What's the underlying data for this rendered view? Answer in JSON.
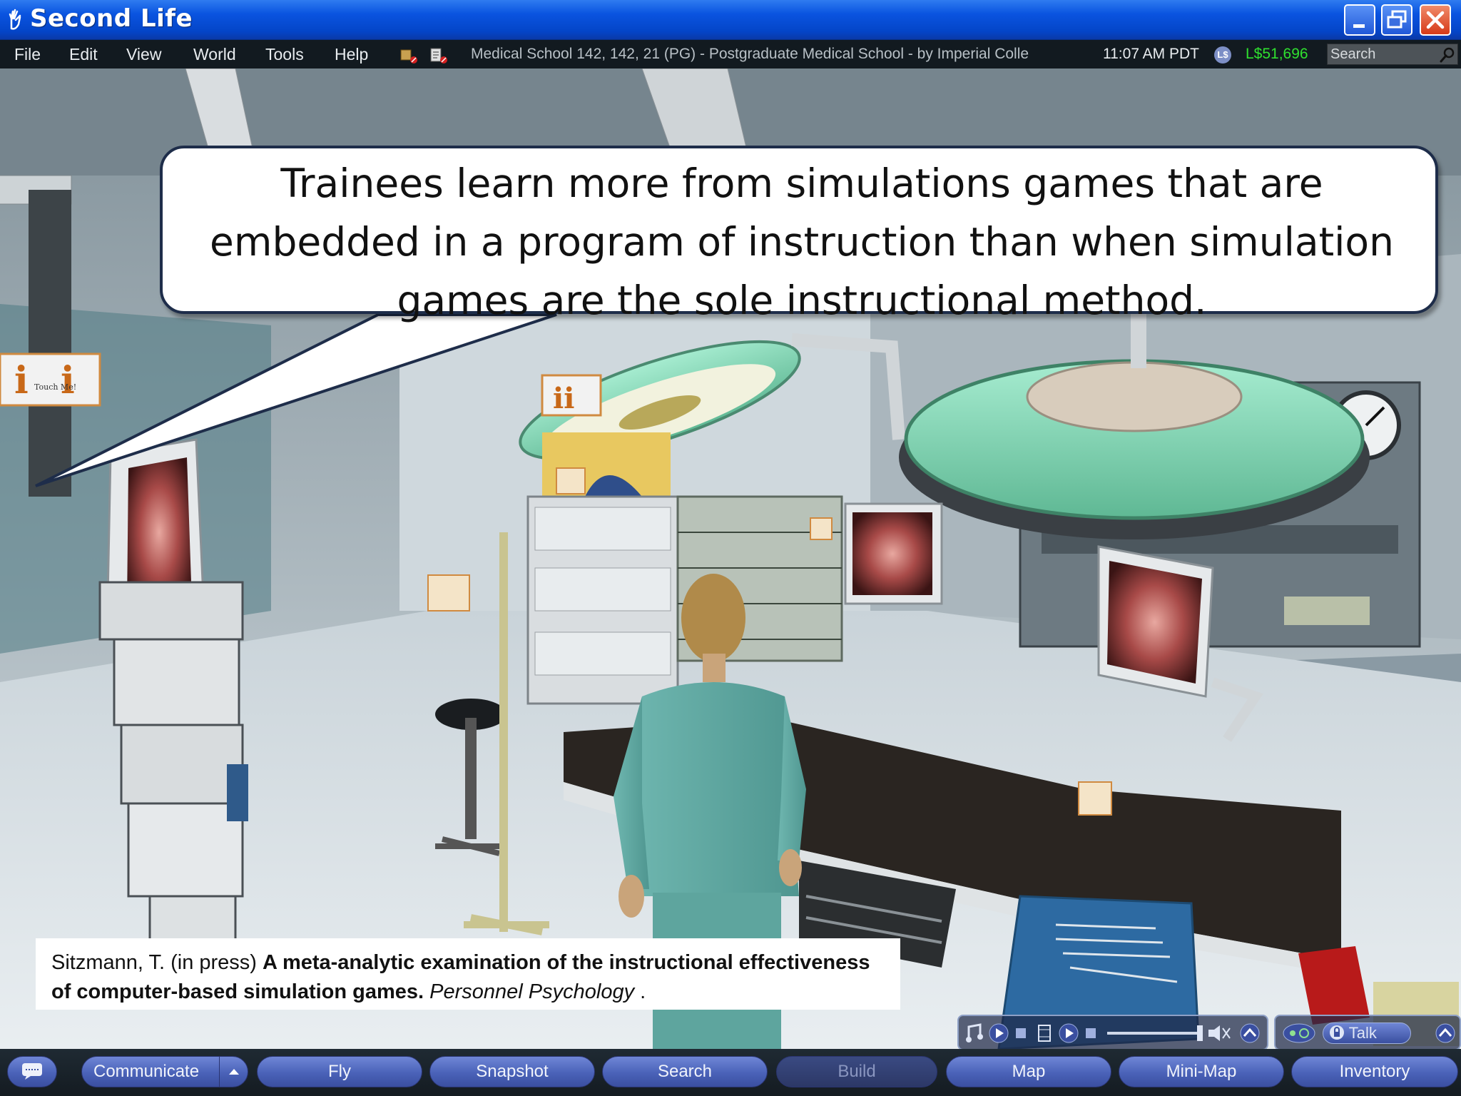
{
  "window": {
    "title": "Second Life"
  },
  "menu": {
    "items": [
      "File",
      "Edit",
      "View",
      "World",
      "Tools",
      "Help"
    ]
  },
  "status": {
    "location": "Medical School 142, 142, 21 (PG) - Postgraduate Medical School -  by Imperial Colle",
    "time": "11:07 AM PDT",
    "currency_icon": "L$",
    "balance": "L$51,696",
    "balance_color": "#2fe02f"
  },
  "search": {
    "placeholder": "Search"
  },
  "scene": {
    "sign_label": "Touch Me!"
  },
  "bubble": {
    "text": "Trainees learn more from simulations games that are embedded in a program of instruction than when simulation games are the sole instructional method."
  },
  "citation": {
    "author": "Sitzmann, T. (in press) ",
    "title": "A meta-analytic examination of the instructional effectiveness of computer-based simulation games.",
    "journal": " Personnel Psychology",
    "trailing": " ."
  },
  "voice": {
    "talk_label": "Talk"
  },
  "toolbar": {
    "communicate": "Communicate",
    "fly": "Fly",
    "snapshot": "Snapshot",
    "search": "Search",
    "build": "Build",
    "map": "Map",
    "minimap": "Mini-Map",
    "inventory": "Inventory"
  },
  "colors": {
    "titlebar": "#0a54e0",
    "menubar": "#121a20",
    "toolbar_button": "#5a72c8"
  }
}
